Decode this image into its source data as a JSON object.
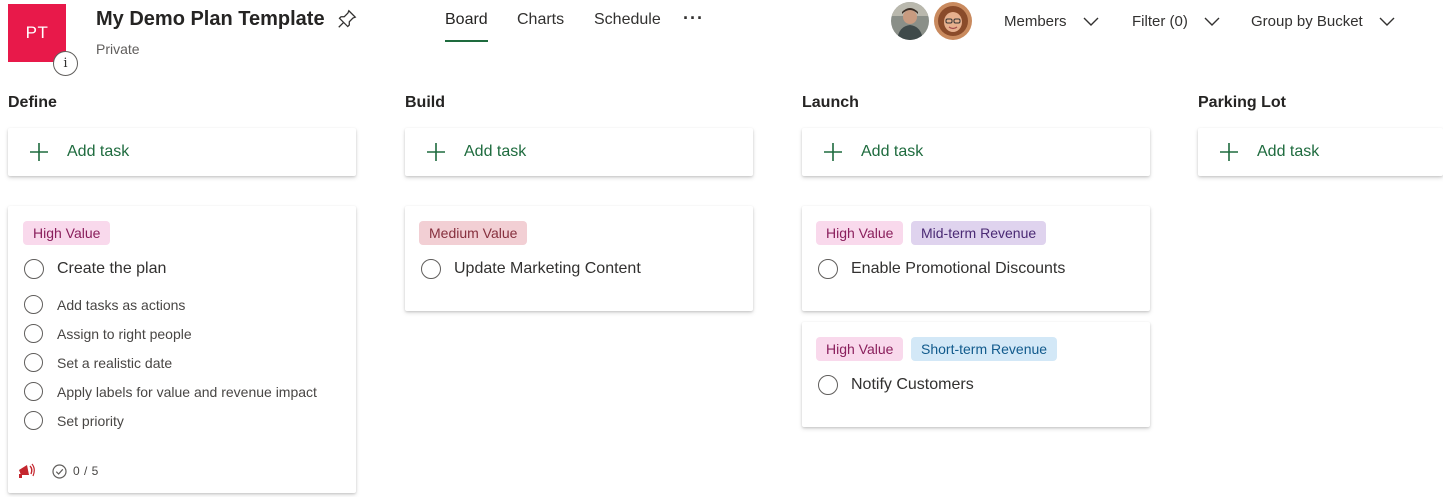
{
  "header": {
    "plan_initials": "PT",
    "info_badge": "i",
    "plan_title": "My Demo Plan Template",
    "plan_privacy": "Private",
    "tabs": [
      {
        "label": "Board",
        "active": true
      },
      {
        "label": "Charts",
        "active": false
      },
      {
        "label": "Schedule",
        "active": false
      }
    ],
    "more_label": "···",
    "members_label": "Members",
    "filter_label": "Filter (0)",
    "group_label": "Group by Bucket",
    "accent_color": "#e8194a",
    "tab_underline_color": "#1e6b3e"
  },
  "buckets": [
    {
      "title": "Define",
      "add_task": "Add task"
    },
    {
      "title": "Build",
      "add_task": "Add task"
    },
    {
      "title": "Launch",
      "add_task": "Add task"
    },
    {
      "title": "Parking Lot",
      "add_task": "Add task"
    }
  ],
  "tasks": {
    "define_1": {
      "labels": [
        "High Value"
      ],
      "title": "Create the plan",
      "checklist": [
        "Add tasks as actions",
        "Assign to right people",
        "Set a realistic date",
        "Apply labels for value and revenue impact",
        "Set priority"
      ],
      "progress": "0 / 5",
      "priority_icon": "urgent-megaphone-icon"
    },
    "build_1": {
      "labels": [
        "Medium Value"
      ],
      "title": "Update Marketing Content"
    },
    "launch_1": {
      "labels": [
        "High Value",
        "Mid-term Revenue"
      ],
      "title": "Enable Promotional Discounts"
    },
    "launch_2": {
      "labels": [
        "High Value",
        "Short-term Revenue"
      ],
      "title": "Notify Customers"
    }
  },
  "label_colors": {
    "high_value_bg": "#f9d9ec",
    "high_value_fg": "#8a1f5c",
    "medium_value_bg": "#f2cfd4",
    "medium_value_fg": "#86303e",
    "mid_term_bg": "#dfd3ee",
    "mid_term_fg": "#4a2a74",
    "short_term_bg": "#d3e8f7",
    "short_term_fg": "#115a8c"
  }
}
